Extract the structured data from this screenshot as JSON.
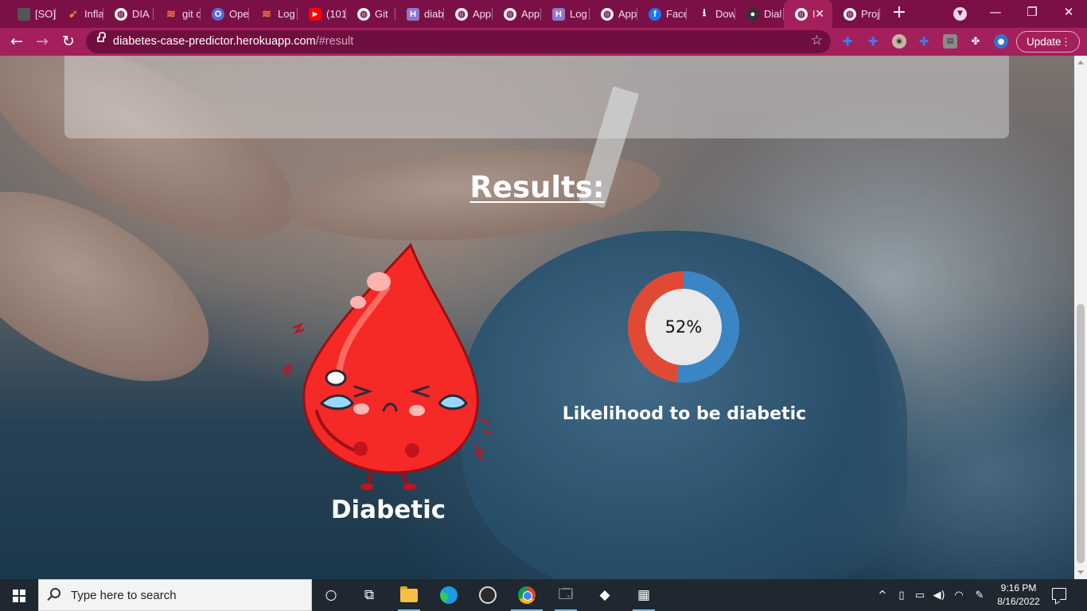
{
  "browser": {
    "tabs": [
      {
        "label": "[SO]",
        "icon": "bar-icon"
      },
      {
        "label": "Infla",
        "icon": "bird-icon"
      },
      {
        "label": "DIA",
        "icon": "globe-icon"
      },
      {
        "label": "git c",
        "icon": "stackoverflow-icon"
      },
      {
        "label": "Ope",
        "icon": "opera-icon"
      },
      {
        "label": "Log",
        "icon": "stackoverflow-icon"
      },
      {
        "label": "(101",
        "icon": "youtube-icon"
      },
      {
        "label": "Git",
        "icon": "globe-icon"
      },
      {
        "label": "diab",
        "icon": "heroku-icon"
      },
      {
        "label": "App",
        "icon": "globe-icon"
      },
      {
        "label": "App",
        "icon": "globe-icon"
      },
      {
        "label": "Log",
        "icon": "heroku-icon"
      },
      {
        "label": "App",
        "icon": "globe-icon"
      },
      {
        "label": "Face",
        "icon": "facebook-icon"
      },
      {
        "label": "Dow",
        "icon": "download-icon"
      },
      {
        "label": "Dial",
        "icon": "github-icon"
      },
      {
        "label": "I",
        "icon": "globe-icon",
        "active": true
      },
      {
        "label": "Proj",
        "icon": "globe-icon"
      }
    ],
    "url_host": "diabetes-case-predictor.herokuapp.com",
    "url_path": "/#result",
    "update_label": "Update"
  },
  "page": {
    "results_title": "Results:",
    "status_label": "Diabetic",
    "likelihood_percent": 52,
    "likelihood_text": "52%",
    "likelihood_caption": "Likelihood to be diabetic",
    "colors": {
      "likelihood_fill": "#3a86c4",
      "remainder_fill": "#e04a35",
      "donut_center": "#e9e9e9",
      "button_green": "#0c9b53",
      "drop_red": "#f52a26"
    }
  },
  "taskbar": {
    "search_placeholder": "Type here to search",
    "time": "9:16 PM",
    "date": "8/16/2022"
  }
}
